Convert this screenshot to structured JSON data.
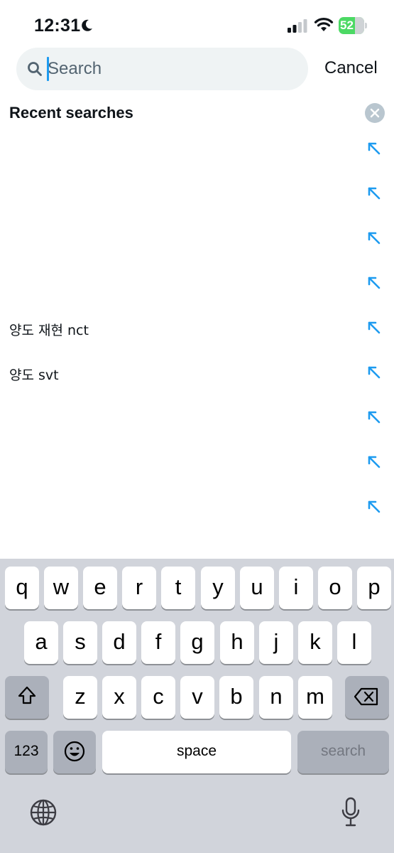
{
  "status_bar": {
    "time": "12:31",
    "battery": "52",
    "icons": [
      "moon-icon",
      "signal-icon",
      "wifi-icon",
      "battery-icon"
    ]
  },
  "search": {
    "placeholder": "Search",
    "value": "",
    "cancel_label": "Cancel"
  },
  "recent": {
    "title": "Recent searches",
    "items": [
      {
        "label": "",
        "icon": "arrow-up-left-icon"
      },
      {
        "label": "",
        "icon": "arrow-up-left-icon"
      },
      {
        "label": "",
        "icon": "arrow-up-left-icon"
      },
      {
        "label": "",
        "icon": "arrow-up-left-icon"
      },
      {
        "label": "양도 재현 nct",
        "icon": "arrow-up-left-icon"
      },
      {
        "label": "양도 svt",
        "icon": "arrow-up-left-icon"
      },
      {
        "label": "",
        "icon": "arrow-up-left-icon"
      },
      {
        "label": "",
        "icon": "arrow-up-left-icon"
      },
      {
        "label": "",
        "icon": "arrow-up-left-icon"
      }
    ]
  },
  "keyboard": {
    "row1": [
      "q",
      "w",
      "e",
      "r",
      "t",
      "y",
      "u",
      "i",
      "o",
      "p"
    ],
    "row2": [
      "a",
      "s",
      "d",
      "f",
      "g",
      "h",
      "j",
      "k",
      "l"
    ],
    "row3": [
      "z",
      "x",
      "c",
      "v",
      "b",
      "n",
      "m"
    ],
    "numbers_label": "123",
    "space_label": "space",
    "return_label": "search"
  },
  "colors": {
    "accent": "#1d9bf0",
    "search_bg": "#eff3f4",
    "keyboard_bg": "#d1d4db",
    "battery_green": "#4cd964"
  }
}
